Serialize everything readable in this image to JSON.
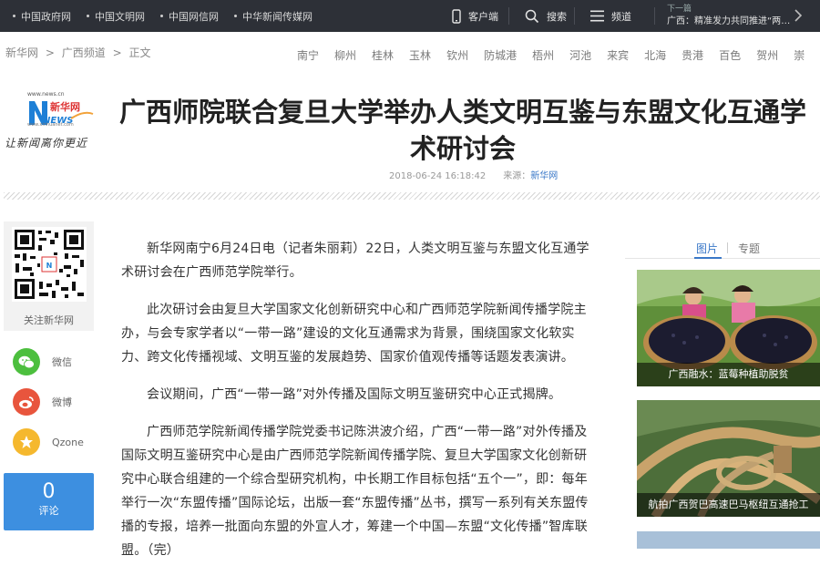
{
  "topbar": {
    "links": [
      "中国政府网",
      "中国文明网",
      "中国网信网",
      "中华新闻传媒网"
    ],
    "client_label": "客户端",
    "search_label": "搜索",
    "channel_label": "频道",
    "next_label": "下一篇",
    "next_title": "广西：精准发力共同推进“两个健康”"
  },
  "breadcrumb": {
    "items": [
      "新华网",
      ">",
      "广西频道",
      ">",
      "正文"
    ]
  },
  "cities": [
    "南宁",
    "柳州",
    "桂林",
    "玉林",
    "钦州",
    "防城港",
    "梧州",
    "河池",
    "来宾",
    "北海",
    "贵港",
    "百色",
    "贺州",
    "崇"
  ],
  "logo": {
    "url_text": "www.news.cn",
    "url_text2": "www.xinhuanet.com",
    "cn_name": "新华网",
    "news_word": "NEWS",
    "slogan": "让新闻离你更近"
  },
  "article": {
    "title": "广西师院联合复旦大学举办人类文明互鉴与东盟文化互通学术研讨会",
    "date": "2018-06-24 16:18:42",
    "source_label": "来源：",
    "source_name": "新华网",
    "paragraphs": [
      "新华网南宁6月24日电（记者朱丽莉）22日，人类文明互鉴与东盟文化互通学术研讨会在广西师范学院举行。",
      "此次研讨会由复旦大学国家文化创新研究中心和广西师范学院新闻传播学院主办，与会专家学者以“一带一路”建设的文化互通需求为背景，围绕国家文化软实力、跨文化传播视域、文明互鉴的发展趋势、国家价值观传播等话题发表演讲。",
      "会议期间，广西“一带一路”对外传播及国际文明互鉴研究中心正式揭牌。",
      "广西师范学院新闻传播学院党委书记陈洪波介绍，广西“一带一路”对外传播及国际文明互鉴研究中心是由广西师范学院新闻传播学院、复旦大学国家文化创新研究中心联合组建的一个综合型研究机构，中长期工作目标包括“五个一”，即：每年举行一次“东盟传播”国际论坛，出版一套“东盟传播”丛书，撰写一系列有关东盟传播的专报，培养一批面向东盟的外宣人才，筹建一个中国—东盟“文化传播”智库联盟。（完）"
    ]
  },
  "share": {
    "qr_label": "关注新华网",
    "wechat": "微信",
    "weibo": "微博",
    "qzone": "Qzone",
    "comment_count": "0",
    "comment_label": "评论"
  },
  "sidebar": {
    "tabs": [
      "图片",
      "专题"
    ],
    "items": [
      {
        "caption": "广西融水：蓝莓种植助脱贫"
      },
      {
        "caption": "航拍广西贺巴高速巴马枢纽互通抢工"
      }
    ]
  },
  "colors": {
    "topbar_bg": "#2d3037",
    "accent_blue": "#3a78c8",
    "comment_bg": "#3d8fe0",
    "wechat_green": "#4cbf3e",
    "weibo_red": "#e8553d",
    "qzone_yellow": "#f5b82e"
  }
}
